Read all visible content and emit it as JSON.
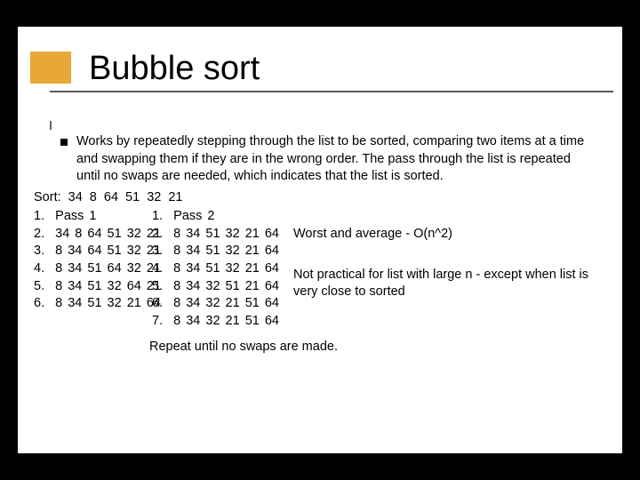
{
  "title": "Bubble sort",
  "bullet": "Works by repeatedly stepping through the list to be sorted, comparing two items at a time and swapping them if they are in the wrong order. The pass through the list is repeated until no swaps are needed, which indicates that the list is sorted.",
  "sort_line": "Sort: 34   8   64   51   32   21",
  "pass1": {
    "header": "1.  Pass 1",
    "rows": [
      "2.  34 8 64 51 32 21",
      "3.  8 34 64 51 32 21",
      "4.  8 34 51 64 32 21",
      "5.  8 34 51 32 64 21",
      "6.  8 34 51 32 21 64"
    ]
  },
  "pass2": {
    "header": "1.  Pass 2",
    "rows": [
      "2.  8 34 51 32 21 64",
      "3.  8 34 51 32 21 64",
      "4.  8 34 51 32 21 64",
      "5.  8 34 32 51 21 64",
      "6.  8 34 32 21 51 64",
      "7.  8 34 32 21 51 64"
    ]
  },
  "sidenote1": "Worst and average - O(n^2)",
  "sidenote2": "Not practical for list with large n - except when list is very close to sorted",
  "repeat": "Repeat until no swaps are made."
}
